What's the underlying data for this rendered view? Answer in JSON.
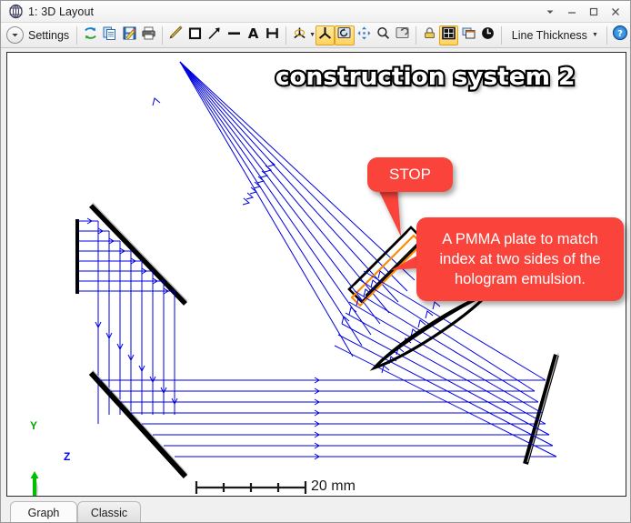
{
  "window": {
    "title": "1: 3D Layout",
    "icon": "lens-icon",
    "controls": {
      "dropdown": "▾",
      "minimize": "–",
      "maximize": "□",
      "close": "✕"
    }
  },
  "toolbar": {
    "settings_label": "Settings",
    "settings_icon": "chevron-down-circle-icon",
    "line_thickness_label": "Line Thickness",
    "line_thickness_caret": "▾",
    "help_icon": "help-question-icon",
    "buttons": [
      {
        "name": "refresh-button",
        "icon": "refresh-arrows-icon",
        "active": false
      },
      {
        "name": "copy-button",
        "icon": "copy-pages-icon",
        "active": false
      },
      {
        "name": "save-button",
        "icon": "save-disk-icon",
        "active": false
      },
      {
        "name": "print-button",
        "icon": "printer-icon",
        "active": false
      },
      {
        "name": "pencil-button",
        "icon": "pencil-icon",
        "active": false
      },
      {
        "name": "rectangle-button",
        "icon": "square-outline-icon",
        "active": false
      },
      {
        "name": "arrow-button",
        "icon": "diagonal-arrow-icon",
        "active": false
      },
      {
        "name": "line-button",
        "icon": "thick-line-icon",
        "active": false
      },
      {
        "name": "text-button",
        "icon": "letter-a-icon",
        "active": false
      },
      {
        "name": "dimension-button",
        "icon": "h-measure-icon",
        "active": false
      },
      {
        "name": "axis-orientation-button",
        "icon": "tripod-axes-icon",
        "active": false
      },
      {
        "name": "isometric-view-button",
        "icon": "three-axis-icon",
        "active": true
      },
      {
        "name": "rotate-view-button",
        "icon": "rotate-screen-icon",
        "active": true
      },
      {
        "name": "pan-button",
        "icon": "four-way-move-icon",
        "active": false
      },
      {
        "name": "zoom-button",
        "icon": "magnifier-icon",
        "active": false
      },
      {
        "name": "undo-view-button",
        "icon": "undo-screen-icon",
        "active": false
      },
      {
        "name": "lock-button",
        "icon": "padlock-icon",
        "active": false
      },
      {
        "name": "fit-window-button",
        "icon": "four-pane-icon",
        "active": true
      },
      {
        "name": "new-window-button",
        "icon": "window-stack-icon",
        "active": false
      },
      {
        "name": "power-button",
        "icon": "power-clock-icon",
        "active": false
      }
    ]
  },
  "scene": {
    "title": "construction system 2",
    "scale_bar": {
      "label": "20 mm",
      "divisions": 5
    },
    "axis_indicator": {
      "vertical_label": "Y",
      "horizontal_label": "Z",
      "vertical_color": "#00c000",
      "horizontal_color": "#0000ff",
      "origin_color": "#d00000"
    },
    "callouts": [
      {
        "name": "stop-callout",
        "text": "STOP",
        "color": "#f9433b"
      },
      {
        "name": "pmma-callout",
        "text": "A PMMA plate to match index at two sides of the hologram emulsion.",
        "color": "#f9433b"
      }
    ],
    "colors": {
      "ray": "#0000e0",
      "mirror": "#000000",
      "plate_outline": "#000000",
      "plate_inner": "#ff8c00",
      "background": "#ffffff"
    },
    "elements": [
      {
        "name": "point-source-fan",
        "type": "diverging-ray-bundle"
      },
      {
        "name": "upper-left-mirror",
        "type": "flat-mirror"
      },
      {
        "name": "left-vertical-mirror",
        "type": "flat-mirror"
      },
      {
        "name": "lower-left-mirror",
        "type": "flat-mirror"
      },
      {
        "name": "pmma-hologram-plate",
        "type": "plate-stack"
      },
      {
        "name": "collimating-lens",
        "type": "lens"
      },
      {
        "name": "right-mirror",
        "type": "flat-mirror"
      }
    ]
  },
  "tabs": [
    {
      "name": "tab-graph",
      "label": "Graph",
      "active": true
    },
    {
      "name": "tab-classic",
      "label": "Classic",
      "active": false
    }
  ]
}
